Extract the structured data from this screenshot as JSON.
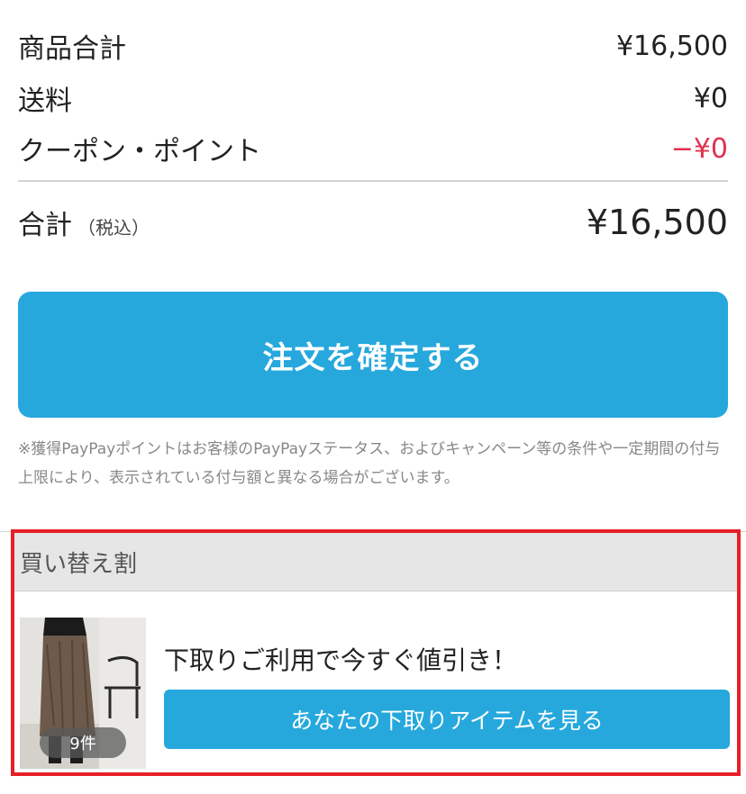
{
  "summary": {
    "subtotal_label": "商品合計",
    "subtotal_value": "¥16,500",
    "shipping_label": "送料",
    "shipping_value": "¥0",
    "coupon_label": "クーポン・ポイント",
    "coupon_value": "−¥0",
    "total_label": "合計",
    "total_tax_note": "（税込）",
    "total_value": "¥16,500"
  },
  "confirm_button_label": "注文を確定する",
  "notice_text": "※獲得PayPayポイントはお客様のPayPayステータス、およびキャンペーン等の条件や一定期間の付与上限により、表示されている付与額と異なる場合がございます。",
  "trade_in": {
    "header": "買い替え割",
    "item_count": "9件",
    "headline": "下取りご利用で今すぐ値引き！",
    "button_label": "あなたの下取りアイテムを見る"
  },
  "colors": {
    "accent": "#26a8dd",
    "discount": "#e0304e",
    "highlight_border": "#e52028"
  }
}
